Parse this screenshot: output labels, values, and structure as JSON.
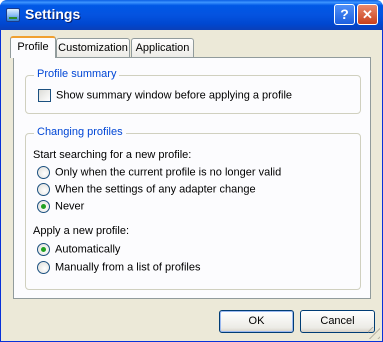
{
  "window": {
    "title": "Settings",
    "help_label": "?",
    "close_label": "✕"
  },
  "tabs": [
    {
      "label": "Profile",
      "active": true
    },
    {
      "label": "Customization",
      "active": false
    },
    {
      "label": "Application",
      "active": false
    }
  ],
  "profile_summary": {
    "title": "Profile summary",
    "checkbox_label": "Show summary window before applying a profile",
    "checked": false
  },
  "changing_profiles": {
    "title": "Changing profiles",
    "search_label": "Start searching for a new profile:",
    "search_options": [
      {
        "label": "Only when the current profile is no longer valid",
        "checked": false
      },
      {
        "label": "When the settings of any adapter change",
        "checked": false
      },
      {
        "label": "Never",
        "checked": true
      }
    ],
    "apply_label": "Apply a new profile:",
    "apply_options": [
      {
        "label": "Automatically",
        "checked": true
      },
      {
        "label": "Manually from a list of profiles",
        "checked": false
      }
    ]
  },
  "buttons": {
    "ok": "OK",
    "cancel": "Cancel"
  }
}
